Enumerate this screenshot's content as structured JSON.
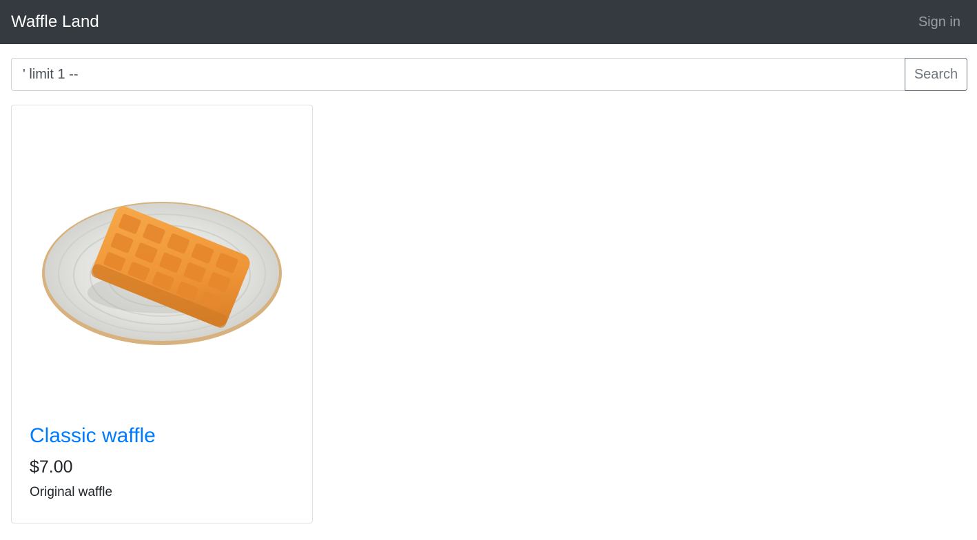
{
  "navbar": {
    "brand": "Waffle Land",
    "sign_in": "Sign in",
    "background": "#343a40"
  },
  "search": {
    "value": "' limit 1 --",
    "button_label": "Search"
  },
  "products": [
    {
      "image_alt": "waffle-on-plate",
      "title": "Classic waffle",
      "price": "$7.00",
      "description": "Original waffle"
    }
  ],
  "colors": {
    "link": "#007bff",
    "text": "#212529",
    "muted": "#6c757d"
  }
}
